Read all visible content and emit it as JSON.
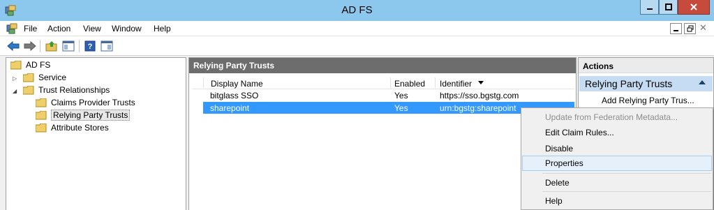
{
  "window": {
    "title": "AD FS",
    "accent": "#8cc8ee"
  },
  "menu": {
    "items": [
      "File",
      "Action",
      "View",
      "Window",
      "Help"
    ]
  },
  "toolbar": {
    "icons": [
      "back-icon",
      "forward-icon",
      "up-folder-icon",
      "show-hide-console-tree-icon",
      "help-icon",
      "show-hide-action-pane-icon"
    ]
  },
  "tree": {
    "root": "AD FS",
    "service": "Service",
    "trust_relationships": "Trust Relationships",
    "claims_provider_trusts": "Claims Provider Trusts",
    "relying_party_trusts": "Relying Party Trusts",
    "attribute_stores": "Attribute Stores"
  },
  "center": {
    "title": "Relying Party Trusts",
    "columns": {
      "display_name": "Display Name",
      "enabled": "Enabled",
      "identifier": "Identifier"
    },
    "rows": [
      {
        "display_name": "bitglass SSO",
        "enabled": "Yes",
        "identifier": "https://sso.bgstg.com"
      },
      {
        "display_name": "sharepoint",
        "enabled": "Yes",
        "identifier": "urn:bgstg:sharepoint"
      }
    ],
    "selected_color": "#3399ff"
  },
  "actions": {
    "title": "Actions",
    "group": "Relying Party Trusts",
    "items": [
      "Add Relying Party Trus..."
    ]
  },
  "context_menu": {
    "items": [
      {
        "label": "Update from Federation Metadata...",
        "disabled": true
      },
      {
        "label": "Edit Claim Rules..."
      },
      {
        "label": "Disable"
      },
      {
        "label": "Properties",
        "highlighted": true
      },
      {
        "label": "Delete"
      },
      {
        "label": "Help"
      }
    ]
  }
}
